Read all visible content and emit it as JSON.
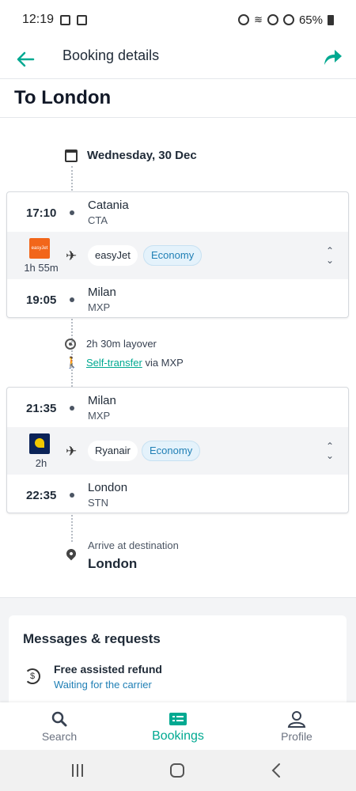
{
  "status_bar": {
    "time": "12:19",
    "battery": "65%"
  },
  "header": {
    "title": "Booking details"
  },
  "trip": {
    "title": "To London"
  },
  "date": "Wednesday, 30 Dec",
  "segments": [
    {
      "depart_time": "17:10",
      "depart_city": "Catania",
      "depart_code": "CTA",
      "carrier": "easyJet",
      "logo_text": "easyJet",
      "cabin": "Economy",
      "duration": "1h 55m",
      "arrive_time": "19:05",
      "arrive_city": "Milan",
      "arrive_code": "MXP"
    },
    {
      "depart_time": "21:35",
      "depart_city": "Milan",
      "depart_code": "MXP",
      "carrier": "Ryanair",
      "cabin": "Economy",
      "duration": "2h",
      "arrive_time": "22:35",
      "arrive_city": "London",
      "arrive_code": "STN"
    }
  ],
  "layover": {
    "text": "2h 30m layover",
    "transfer_link": "Self-transfer",
    "transfer_suffix": "via MXP"
  },
  "arrival": {
    "label": "Arrive at destination",
    "city": "London"
  },
  "messages": {
    "title": "Messages & requests",
    "item_title": "Free assisted refund",
    "item_status": "Waiting for the carrier"
  },
  "bottom_nav": {
    "search": "Search",
    "bookings": "Bookings",
    "profile": "Profile"
  },
  "colors": {
    "accent": "#00a991",
    "link_blue": "#1f7fb5",
    "easyjet": "#f2661a",
    "ryanair": "#0b2358"
  },
  "icons": [
    "back-arrow-icon",
    "share-icon",
    "calendar-icon",
    "plane-icon",
    "expand-icon",
    "clock-icon",
    "walk-icon",
    "pin-icon",
    "refund-icon",
    "search-icon",
    "bookings-icon",
    "profile-icon"
  ]
}
